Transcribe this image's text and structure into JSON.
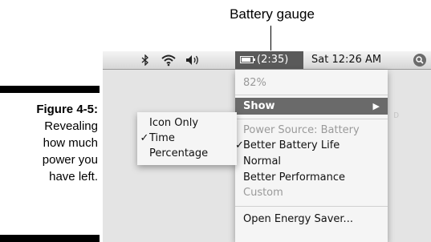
{
  "callout": {
    "label": "Battery gauge"
  },
  "caption": {
    "figure_label": "Figure 4-5:",
    "lines": [
      "Revealing",
      "how much",
      "power you",
      "have left."
    ]
  },
  "menubar": {
    "bluetooth_glyph": "∦",
    "battery_time": "(2:35)",
    "clock": "Sat 12:26 AM",
    "icons": [
      "bluetooth-icon",
      "wifi-icon",
      "volume-icon",
      "battery-icon",
      "spotlight-icon"
    ]
  },
  "battery_menu": {
    "percent": "82%",
    "show_label": "Show",
    "show_arrow": "▶",
    "power_source": "Power Source: Battery",
    "options": [
      {
        "label": "Better Battery Life",
        "checked": true,
        "enabled": true
      },
      {
        "label": "Normal",
        "checked": false,
        "enabled": true
      },
      {
        "label": "Better Performance",
        "checked": false,
        "enabled": true
      },
      {
        "label": "Custom",
        "checked": false,
        "enabled": false
      }
    ],
    "check_glyph": "✓",
    "open_energy_saver": "Open Energy Saver..."
  },
  "show_submenu": {
    "items": [
      {
        "label": "Icon Only",
        "checked": false
      },
      {
        "label": "Time",
        "checked": true
      },
      {
        "label": "Percentage",
        "checked": false
      }
    ]
  },
  "battery_level": 0.82,
  "colors": {
    "menu_highlight": "#6a6a6a",
    "menubar_selected": "#5a5a5a"
  }
}
